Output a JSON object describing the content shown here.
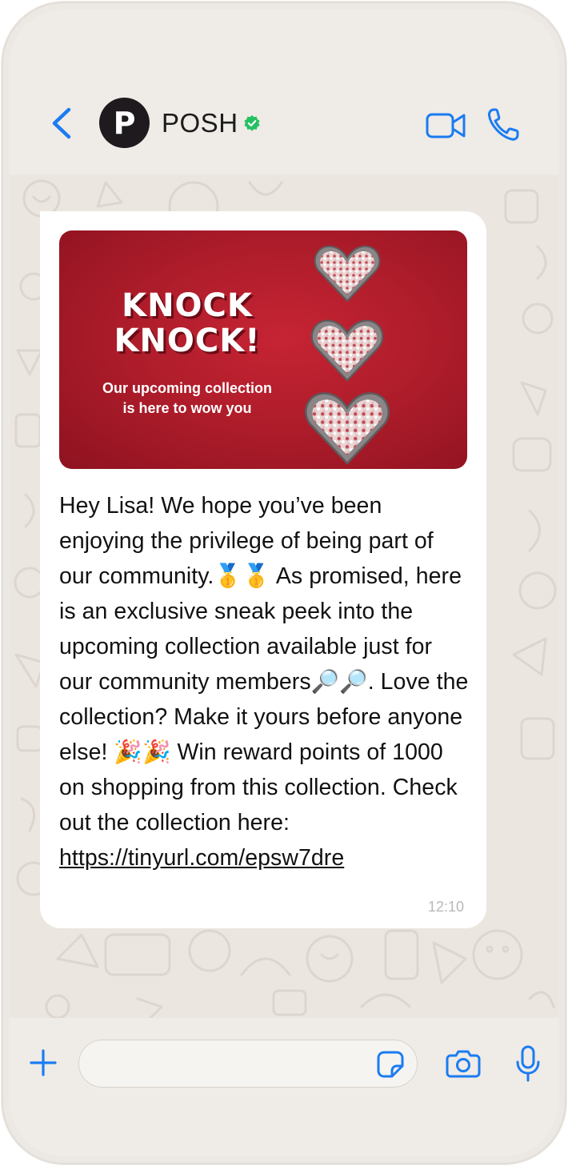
{
  "header": {
    "avatar_letter": "P",
    "contact_name": "POSH",
    "verified": true
  },
  "message": {
    "banner": {
      "headline_line1": "KNOCK",
      "headline_line2": "KNOCK!",
      "subtitle_line1": "Our upcoming collection",
      "subtitle_line2": "is here to wow you"
    },
    "body": "Hey Lisa! We hope you’ve been enjoying the privilege of being part of our community.🥇🥇 As promised, here is an exclusive sneak peek into the upcoming collection available just for our community members🔎🔎. Love the collection? Make it yours before anyone else! 🎉🎉 Win reward points of 1000 on shopping from this collection. Check out the collection here: ",
    "link": "https://tinyurl.com/epsw7dre",
    "time": "12:10"
  },
  "composer": {
    "placeholder": ""
  },
  "icons": {
    "back": "chevron-left-icon",
    "verified": "verified-check-icon",
    "video": "video-camera-icon",
    "call": "phone-icon",
    "plus": "plus-icon",
    "sticker": "sticker-icon",
    "camera": "camera-icon",
    "mic": "microphone-icon"
  },
  "colors": {
    "accent": "#1a7cf2",
    "verified": "#25c162",
    "banner_red": "#b01e2c",
    "bubble": "#ffffff",
    "chat_bg": "#ebe6e0"
  }
}
